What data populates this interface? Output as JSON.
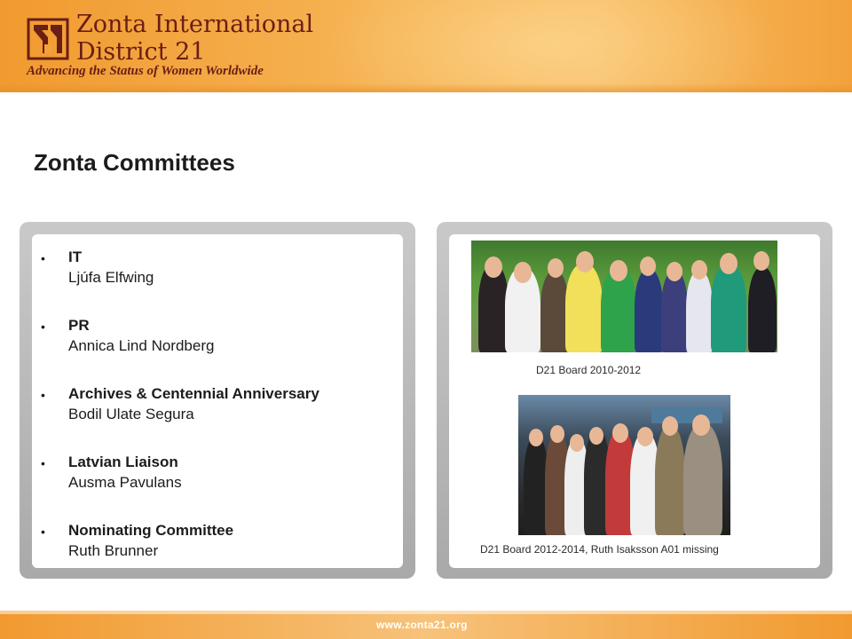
{
  "header": {
    "title_line1": "Zonta International",
    "title_line2": "District 21",
    "tagline": "Advancing the Status of Women Worldwide"
  },
  "page_title": "Zonta Committees",
  "committees": [
    {
      "name": "IT",
      "person": "Ljúfa Elfwing"
    },
    {
      "name": "PR",
      "person": "Annica Lind Nordberg"
    },
    {
      "name": "Archives & Centennial Anniversary",
      "person": "Bodil Ulate Segura"
    },
    {
      "name": "Latvian  Liaison",
      "person": "Ausma Pavulans"
    },
    {
      "name": "Nominating   Committee",
      "person": "Ruth Brunner"
    }
  ],
  "photos": [
    {
      "caption": "D21 Board 2010-2012"
    },
    {
      "caption": "D21 Board 2012-2014,  Ruth Isaksson A01 missing"
    }
  ],
  "footer": {
    "url": "www.zonta21.org"
  },
  "colors": {
    "brand_orange": "#f19a2f",
    "brand_maroon": "#6b1e14"
  }
}
